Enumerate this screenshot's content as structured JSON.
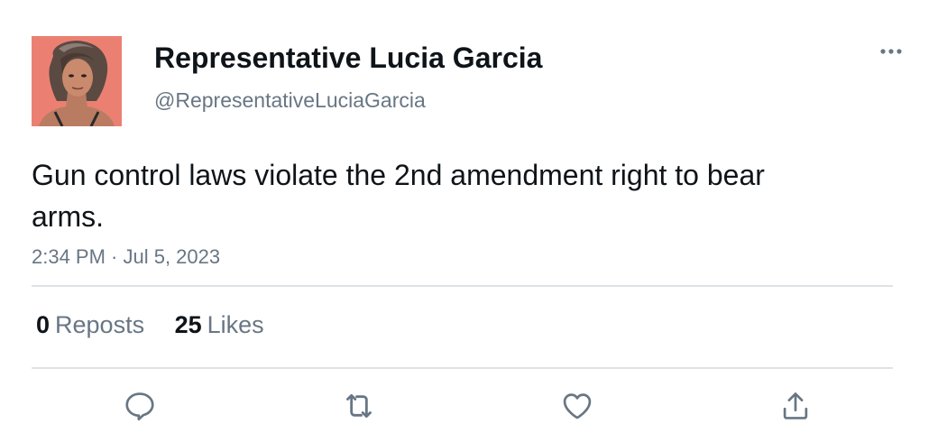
{
  "tweet": {
    "author": {
      "display_name": "Representative Lucia Garcia",
      "handle": "@RepresentativeLuciaGarcia",
      "avatar": "profile-photo"
    },
    "text": "Gun control laws violate the 2nd amendment right to bear arms.",
    "timestamp": "2:34 PM · Jul 5, 2023",
    "stats": {
      "reposts_count": "0",
      "reposts_label": "Reposts",
      "likes_count": "25",
      "likes_label": "Likes"
    },
    "actions": [
      "reply-icon",
      "repost-icon",
      "like-icon",
      "share-icon"
    ],
    "more_icon": "more-horizontal-icon"
  },
  "colors": {
    "text_primary": "#0f1419",
    "text_secondary": "#687684",
    "divider": "#dfe3e6",
    "icon": "#687684",
    "avatar_background": "#e97a6d"
  }
}
